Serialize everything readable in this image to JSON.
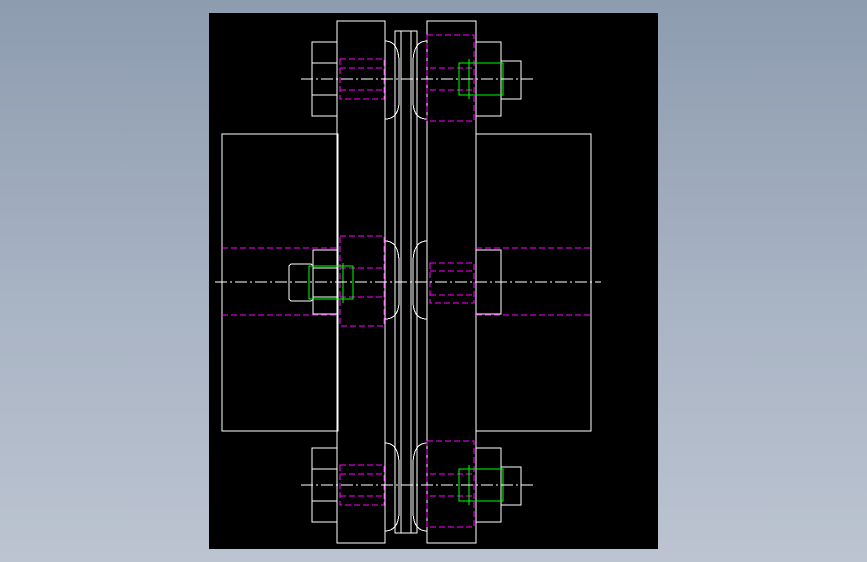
{
  "window": {
    "background_gradient": [
      "#8e9cb0",
      "#bcc4d1"
    ]
  },
  "viewport": {
    "background": "#000000"
  },
  "drawing": {
    "subject": "flexible-coupling-side-view",
    "layer_colors": {
      "outline": "#ffffff",
      "hidden_lines": "#ff00ff",
      "thread_detail": "#00ff00",
      "center_lines": "#ffffff"
    }
  }
}
